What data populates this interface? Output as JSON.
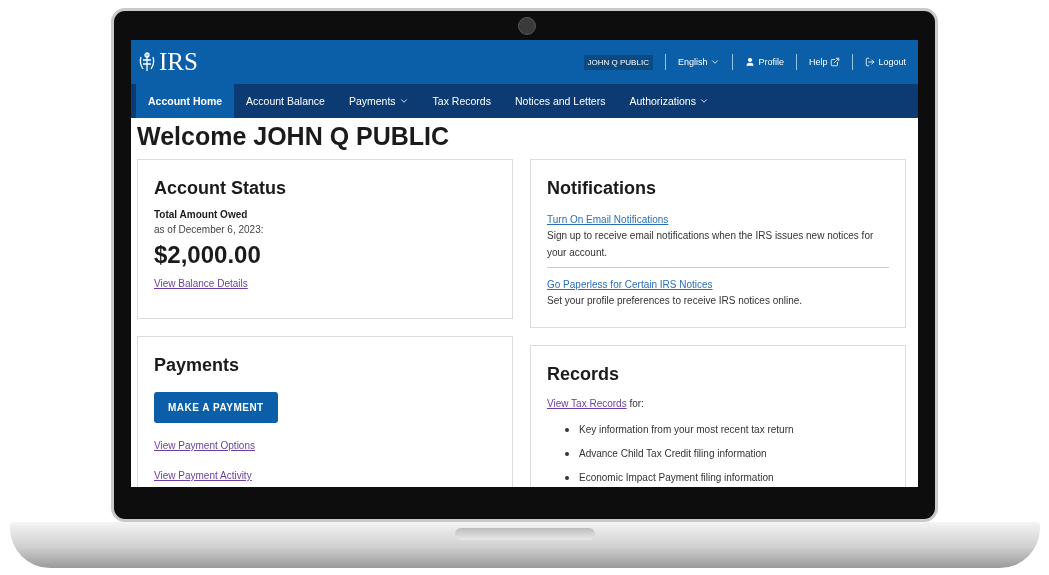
{
  "header": {
    "logo_text": "IRS",
    "user_name": "JOHN Q PUBLIC",
    "links": [
      {
        "kind": "dropdown",
        "label": "English"
      },
      {
        "kind": "profile",
        "label": "Profile"
      },
      {
        "kind": "external",
        "label": "Help"
      },
      {
        "kind": "logout",
        "label": "Logout"
      }
    ]
  },
  "nav": [
    {
      "label": "Account Home",
      "selected": true,
      "dropdown": false
    },
    {
      "label": "Account Balance",
      "selected": false,
      "dropdown": false
    },
    {
      "label": "Payments",
      "selected": false,
      "dropdown": true
    },
    {
      "label": "Tax Records",
      "selected": false,
      "dropdown": false
    },
    {
      "label": "Notices and Letters",
      "selected": false,
      "dropdown": false
    },
    {
      "label": "Authorizations",
      "selected": false,
      "dropdown": true
    }
  ],
  "welcome": "Welcome JOHN Q PUBLIC",
  "account_status": {
    "title": "Account Status",
    "label": "Total Amount Owed",
    "date": "as of December 6, 2023:",
    "amount": "$2,000.00",
    "link": "View Balance Details"
  },
  "payments": {
    "title": "Payments",
    "button": "MAKE A PAYMENT",
    "links": [
      "View Payment Options",
      "View Payment Activity"
    ]
  },
  "notifications": {
    "title": "Notifications",
    "items": [
      {
        "link": "Turn On Email Notifications",
        "text": "Sign up to receive email notifications when the IRS issues new notices for your account."
      },
      {
        "link": "Go Paperless for Certain IRS Notices",
        "text": "Set your profile preferences to receive IRS notices online."
      }
    ]
  },
  "records": {
    "title": "Records",
    "intro_link": "View Tax Records",
    "intro_suffix": " for:",
    "items": [
      "Key information from your most recent tax return",
      "Advance Child Tax Credit filing information",
      "Economic Impact Payment filing information"
    ]
  }
}
